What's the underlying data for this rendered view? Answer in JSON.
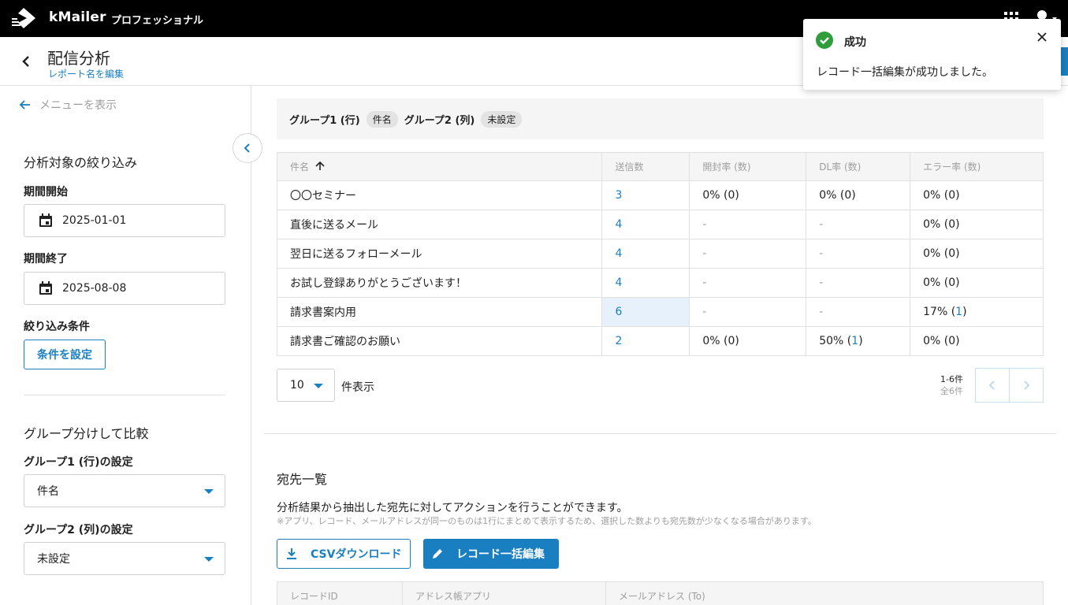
{
  "app": {
    "brand": "kMailer",
    "edition": "プロフェッショナル"
  },
  "header": {
    "title": "配信分析",
    "rename_link": "レポート名を編集"
  },
  "sidebar": {
    "show_menu": "メニューを表示",
    "filter_title": "分析対象の絞り込み",
    "start_label": "期間開始",
    "start_value": "2025-01-01",
    "end_label": "期間終了",
    "end_value": "2025-08-08",
    "condition_label": "絞り込み条件",
    "condition_button": "条件を設定",
    "compare_title": "グループ分けして比較",
    "group1_label": "グループ1 (行)の設定",
    "group1_value": "件名",
    "group2_label": "グループ2 (列)の設定",
    "group2_value": "未設定"
  },
  "group_bar": {
    "g1_label": "グループ1 (行)",
    "g1_value": "件名",
    "g2_label": "グループ2 (列)",
    "g2_value": "未設定"
  },
  "table": {
    "columns": [
      "件名",
      "送信数",
      "開封率 (数)",
      "DL率 (数)",
      "エラー率 (数)"
    ],
    "rows": [
      {
        "subject": "〇〇セミナー",
        "sent": "3",
        "open": "0% (0)",
        "dl": "0% (0)",
        "err": "0% (0)"
      },
      {
        "subject": "直後に送るメール",
        "sent": "4",
        "open": "-",
        "dl": "-",
        "err": "0% (0)"
      },
      {
        "subject": "翌日に送るフォローメール",
        "sent": "4",
        "open": "-",
        "dl": "-",
        "err": "0% (0)"
      },
      {
        "subject": "お試し登録ありがとうございます！",
        "sent": "4",
        "open": "-",
        "dl": "-",
        "err": "0% (0)"
      },
      {
        "subject": "請求書案内用",
        "sent": "6",
        "open": "-",
        "dl": "-",
        "err_pct": "17% (",
        "err_num": "1",
        "err_close": ")"
      },
      {
        "subject": "請求書ご確認のお願い",
        "sent": "2",
        "open": "0% (0)",
        "dl_pct": "50% (",
        "dl_num": "1",
        "dl_close": ")",
        "err": "0% (0)"
      }
    ]
  },
  "pagination": {
    "per_page": "10",
    "per_page_label": "件表示",
    "range": "1-6件",
    "total": "全6件"
  },
  "recipients": {
    "title": "宛先一覧",
    "description": "分析結果から抽出した宛先に対してアクションを行うことができます。",
    "note": "※アプリ、レコード、メールアドレスが同一のものは1行にまとめて表示するため、選択した数よりも宛先数が少なくなる場合があります。",
    "csv_button": "CSVダウンロード",
    "bulk_edit_button": "レコード一括編集",
    "columns": [
      "レコードID",
      "アドレス帳アプリ",
      "メールアドレス (To)"
    ]
  },
  "toast": {
    "title": "成功",
    "message": "レコード一括編集が成功しました。"
  },
  "colors": {
    "accent": "#1a7fc1",
    "success": "#2e9d3a",
    "topbar": "#000000"
  }
}
